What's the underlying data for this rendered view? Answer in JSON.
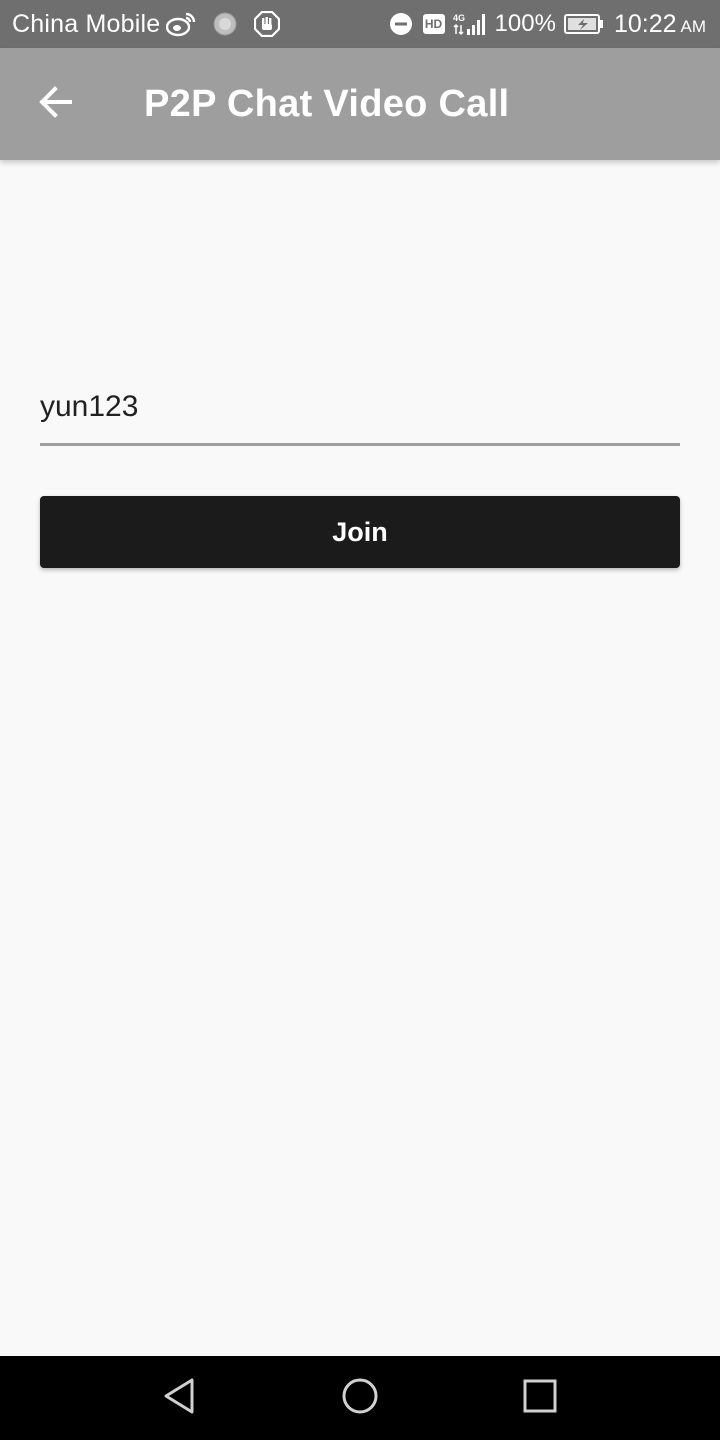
{
  "status_bar": {
    "carrier": "China Mobile",
    "hd_badge": "HD",
    "battery_percent": "100%",
    "time": "10:22",
    "ampm": "AM",
    "icons": [
      "weibo-icon",
      "loading-icon",
      "hand-icon",
      "do-not-disturb-icon",
      "hd-icon",
      "4g-signal-icon",
      "battery-charging-icon"
    ]
  },
  "app_bar": {
    "back_icon": "arrow-back-icon",
    "title": "P2P Chat Video Call"
  },
  "form": {
    "room_value": "yun123",
    "join_label": "Join"
  },
  "nav_bar": {
    "icons": [
      "nav-back-icon",
      "nav-home-icon",
      "nav-recents-icon"
    ]
  },
  "colors": {
    "status_bar_bg": "#6f6f6f",
    "app_bar_bg": "#9e9e9e",
    "page_bg": "#f9f9f9",
    "button_bg": "#1b1b1b",
    "nav_bar_bg": "#000000"
  }
}
